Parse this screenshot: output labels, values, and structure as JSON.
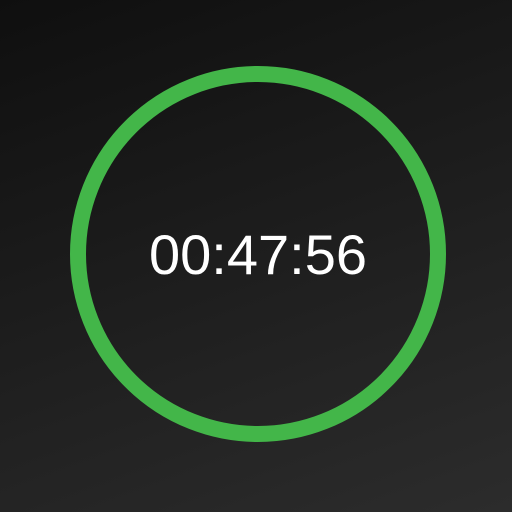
{
  "timer": {
    "time_text": "00:47:56",
    "progress": 1.0,
    "ring_color": "#43b649",
    "text_color": "#ffffff",
    "background_top": "#0f0f0f",
    "background_bottom": "#2c2c2c"
  }
}
